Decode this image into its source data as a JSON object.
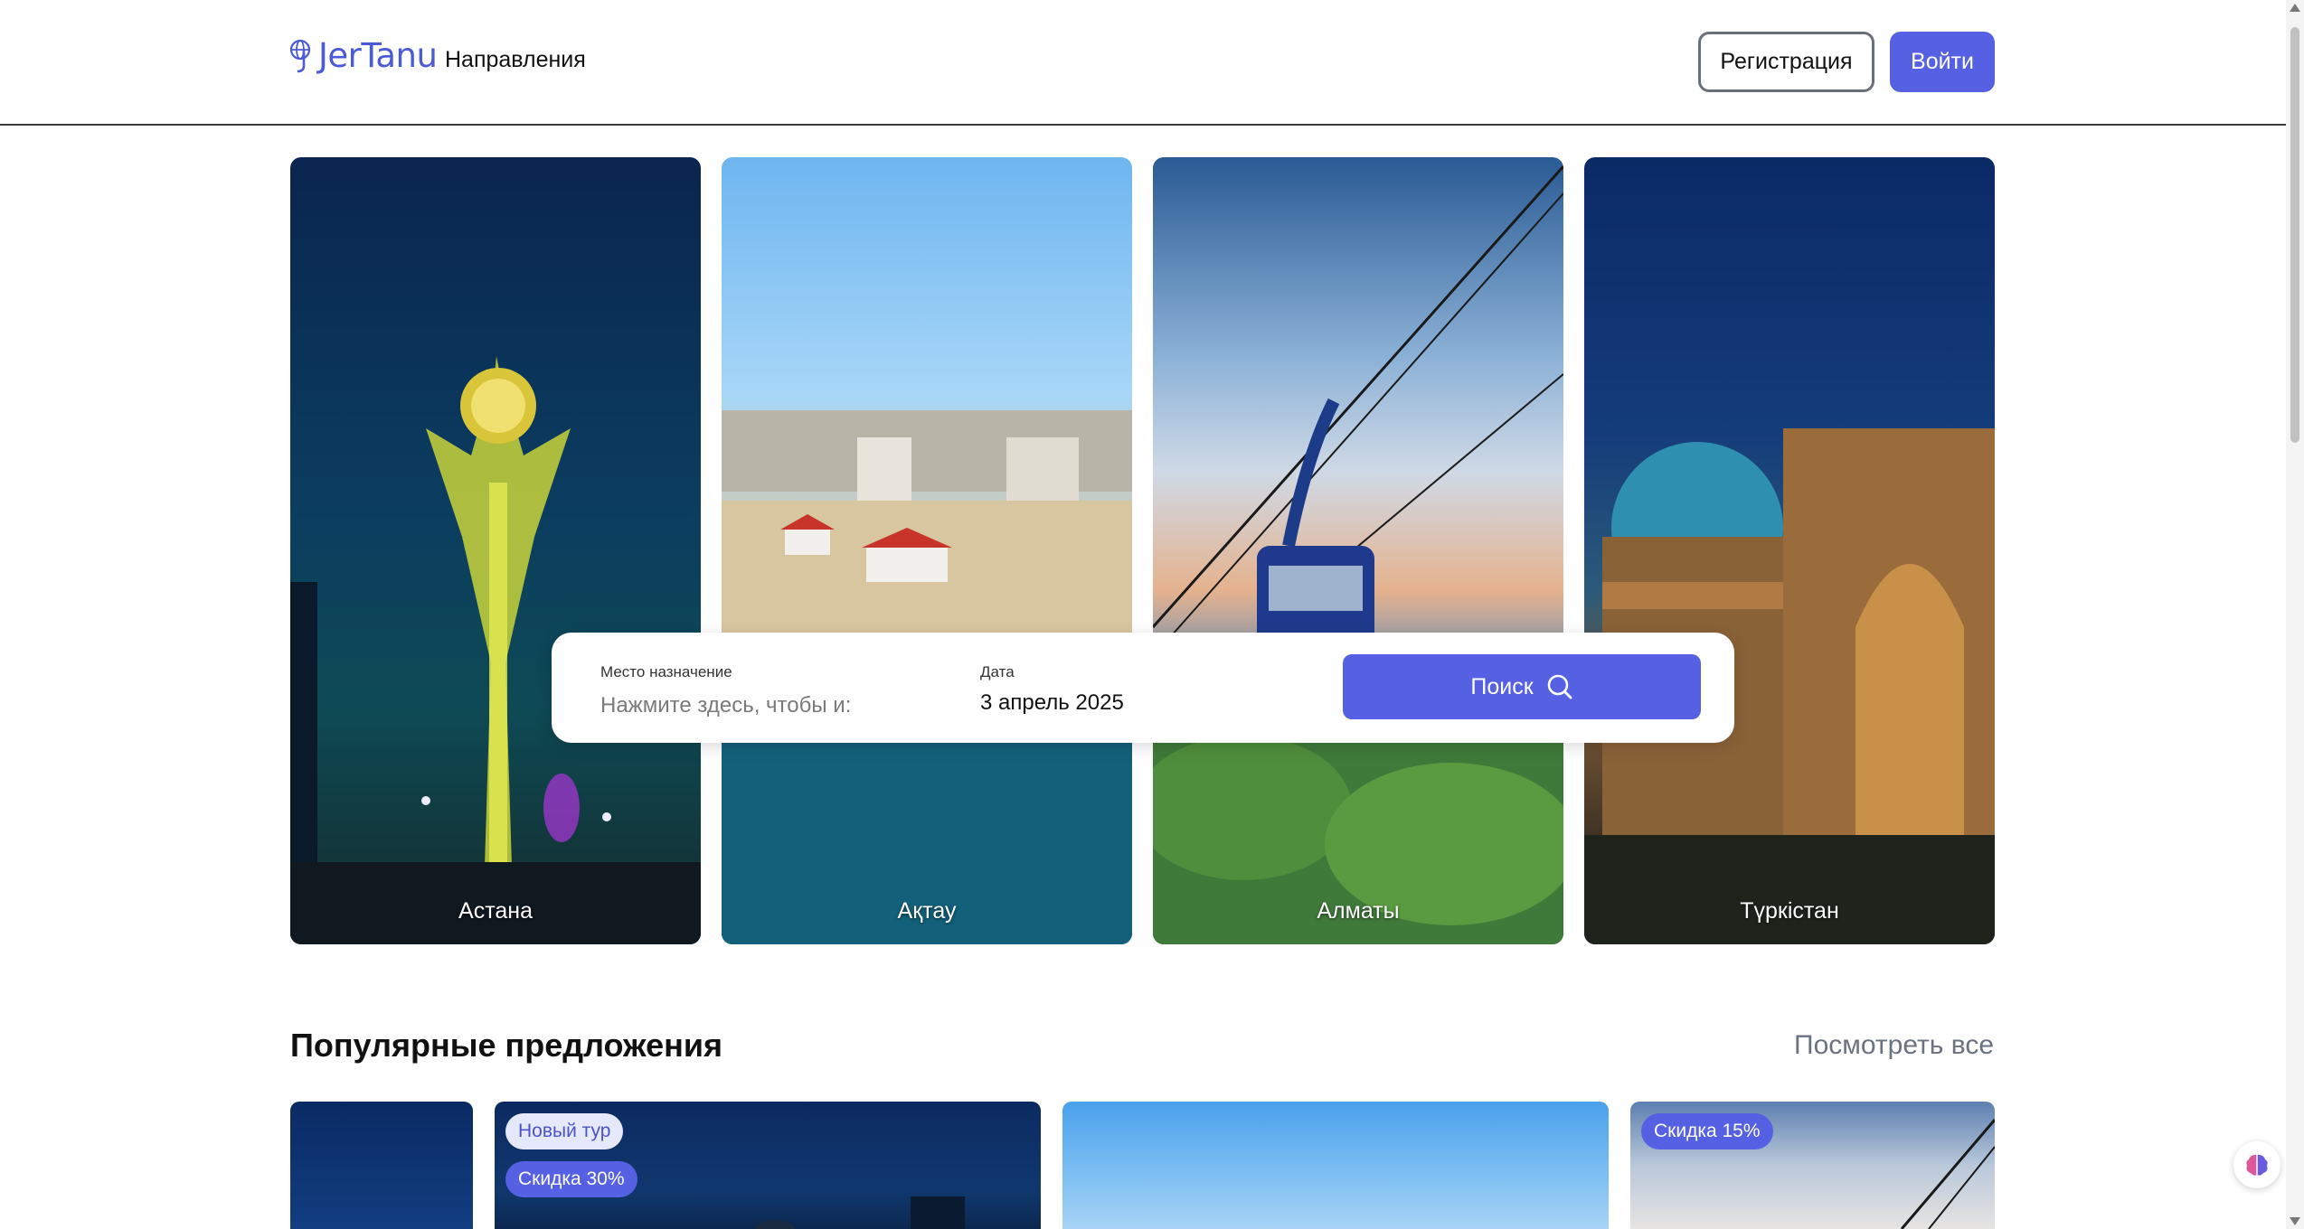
{
  "app": {
    "logo_text": "JerTanu",
    "brand_color": "#5560e2"
  },
  "header": {
    "nav_destinations": "Направления",
    "register_label": "Регистрация",
    "login_label": "Войти"
  },
  "destinations": [
    {
      "name": "Астана"
    },
    {
      "name": "Ақтау"
    },
    {
      "name": "Алматы"
    },
    {
      "name": "Түркістан"
    }
  ],
  "search": {
    "destination_label": "Место назначение",
    "destination_placeholder": "Нажмите здесь, чтобы и:",
    "destination_value": "",
    "date_label": "Дата",
    "date_value": "3 апрель 2025",
    "button_label": "Поиск"
  },
  "popular": {
    "title": "Популярные предложения",
    "see_all": "Посмотреть все",
    "offers": [
      {
        "badges": []
      },
      {
        "badges": [
          "Новый тур",
          "Скидка 30%"
        ]
      },
      {
        "badges": []
      },
      {
        "badges": [
          "Скидка 15%"
        ]
      }
    ]
  },
  "icons": {
    "search": "search-icon",
    "globe_logo": "globe-icon",
    "extension": "brain-icon"
  }
}
